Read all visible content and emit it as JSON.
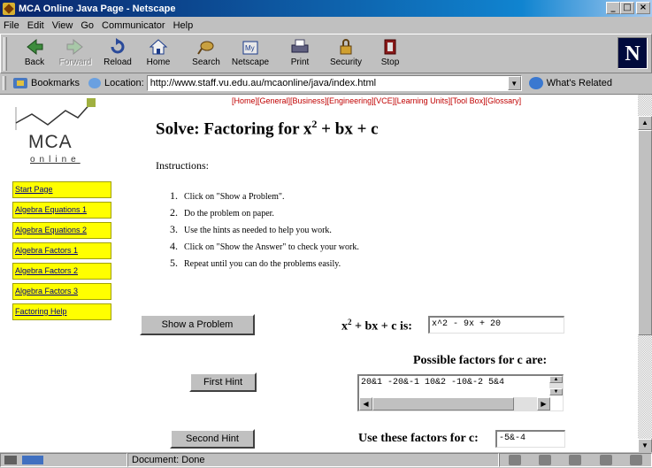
{
  "window": {
    "title": "MCA Online Java Page - Netscape",
    "buttons": {
      "minimize": "_",
      "maximize": "□",
      "close": "×"
    }
  },
  "menu": [
    "File",
    "Edit",
    "View",
    "Go",
    "Communicator",
    "Help"
  ],
  "toolbar": [
    {
      "label": "Back",
      "icon": "back-arrow-icon",
      "enabled": true
    },
    {
      "label": "Forward",
      "icon": "forward-arrow-icon",
      "enabled": false
    },
    {
      "label": "Reload",
      "icon": "reload-icon",
      "enabled": true
    },
    {
      "label": "Home",
      "icon": "home-icon",
      "enabled": true
    },
    {
      "label": "Search",
      "icon": "search-icon",
      "enabled": true
    },
    {
      "label": "Netscape",
      "icon": "netscape-icon",
      "enabled": true
    },
    {
      "label": "Print",
      "icon": "print-icon",
      "enabled": true
    },
    {
      "label": "Security",
      "icon": "lock-icon",
      "enabled": true
    },
    {
      "label": "Stop",
      "icon": "stop-icon",
      "enabled": true
    }
  ],
  "brand_logo": "N",
  "locationbar": {
    "bookmarks_label": "Bookmarks",
    "location_label": "Location:",
    "url": "http://www.staff.vu.edu.au/mcaonline/java/index.html",
    "related_label": "What's Related"
  },
  "page": {
    "top_links": "[Home][General][Business][Engineering][VCE][Learning Units][Tool Box][Glossary]",
    "logo": {
      "text": "MCA",
      "sub": "online"
    },
    "title_prefix": "Solve: Factoring for x",
    "title_sup": "2",
    "title_suffix": " + bx + c",
    "instructions_heading": "Instructions:",
    "steps": [
      "Click on \"Show a Problem\".",
      "Do the problem on paper.",
      "Use the hints as needed to help you work.",
      "Click on \"Show the Answer\" to check your work.",
      "Repeat until you can do the problems easily."
    ],
    "nav": [
      "Start Page",
      "Algebra Equations 1",
      "Algebra Equations 2",
      "Algebra Factors 1",
      "Algebra Factors 2",
      "Algebra Factors 3",
      "Factoring Help"
    ],
    "applet": {
      "show_problem_btn": "Show a Problem",
      "problem_label_pre": "x",
      "problem_label_sup": "2",
      "problem_label_post": " + bx + c is:",
      "problem_value": "x^2 - 9x + 20",
      "factors_label": "Possible factors for c are:",
      "factors_value": "20&1  -20&-1  10&2  -10&-2  5&4",
      "first_hint_btn": "First Hint",
      "second_hint_btn": "Second Hint",
      "use_factors_label": "Use these factors for c:",
      "use_factors_value": "-5&-4"
    }
  },
  "statusbar": {
    "text": "Document: Done"
  },
  "colors": {
    "titlebar": "#0a246a",
    "nav_bg": "#ffff00",
    "link": "#c00000"
  }
}
